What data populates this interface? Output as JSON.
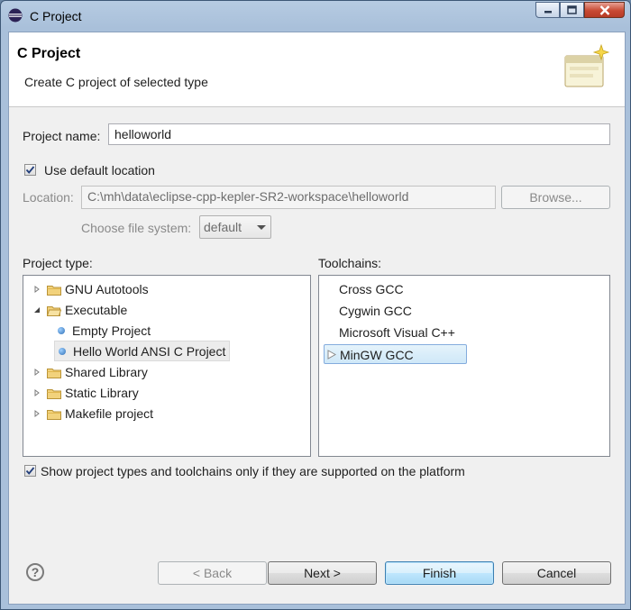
{
  "window": {
    "title": "C Project",
    "minimize_icon": "minimize-icon",
    "maximize_icon": "maximize-icon",
    "close_icon": "close-icon"
  },
  "banner": {
    "title": "C Project",
    "description": "Create C project of selected type"
  },
  "form": {
    "project_name_label": "Project name:",
    "project_name_value": "helloworld",
    "use_default_label": "Use default location",
    "use_default_checked": true,
    "location_label": "Location:",
    "location_value": "C:\\mh\\data\\eclipse-cpp-kepler-SR2-workspace\\helloworld",
    "browse_label": "Browse...",
    "file_system_label": "Choose file system:",
    "file_system_value": "default"
  },
  "project_type": {
    "label": "Project type:",
    "items": [
      {
        "label": "GNU Autotools",
        "kind": "folder",
        "expanded": false
      },
      {
        "label": "Executable",
        "kind": "folder",
        "expanded": true
      },
      {
        "label": "Empty Project",
        "kind": "leaf"
      },
      {
        "label": "Hello World ANSI C Project",
        "kind": "leaf",
        "selected": true
      },
      {
        "label": "Shared Library",
        "kind": "folder",
        "expanded": false
      },
      {
        "label": "Static Library",
        "kind": "folder",
        "expanded": false
      },
      {
        "label": "Makefile project",
        "kind": "folder",
        "expanded": false
      }
    ]
  },
  "toolchains": {
    "label": "Toolchains:",
    "items": [
      {
        "label": "Cross GCC"
      },
      {
        "label": "Cygwin GCC"
      },
      {
        "label": "Microsoft Visual C++"
      },
      {
        "label": "MinGW GCC",
        "selected": true
      }
    ]
  },
  "filter": {
    "label": "Show project types and toolchains only if they are supported on the platform",
    "checked": true
  },
  "buttons": {
    "back": "< Back",
    "next": "Next >",
    "finish": "Finish",
    "cancel": "Cancel",
    "help": "?"
  },
  "colors": {
    "selection": "#cfe8f8",
    "titlebar": "#b6cbe2",
    "close_button": "#c84a33"
  }
}
